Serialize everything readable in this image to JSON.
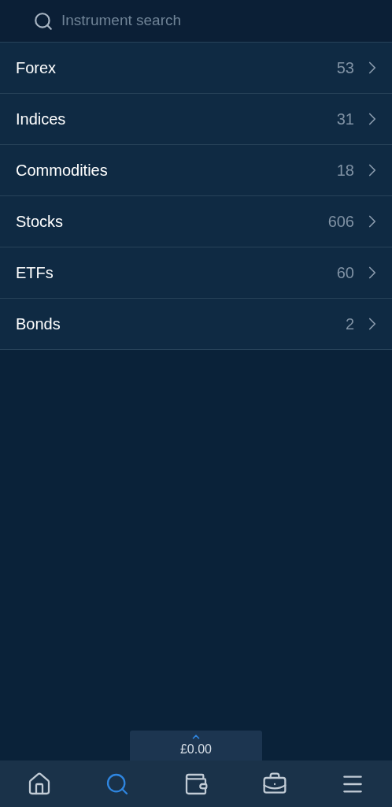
{
  "search": {
    "placeholder": "Instrument search"
  },
  "categories": [
    {
      "label": "Forex",
      "count": "53"
    },
    {
      "label": "Indices",
      "count": "31"
    },
    {
      "label": "Commodities",
      "count": "18"
    },
    {
      "label": "Stocks",
      "count": "606"
    },
    {
      "label": "ETFs",
      "count": "60"
    },
    {
      "label": "Bonds",
      "count": "2"
    }
  ],
  "balance": {
    "amount": "£0.00"
  },
  "nav": [
    {
      "kind": "home",
      "selected": false
    },
    {
      "kind": "search",
      "selected": true
    },
    {
      "kind": "wallet",
      "selected": false
    },
    {
      "kind": "portfolio",
      "selected": false
    },
    {
      "kind": "menu",
      "selected": false
    }
  ]
}
